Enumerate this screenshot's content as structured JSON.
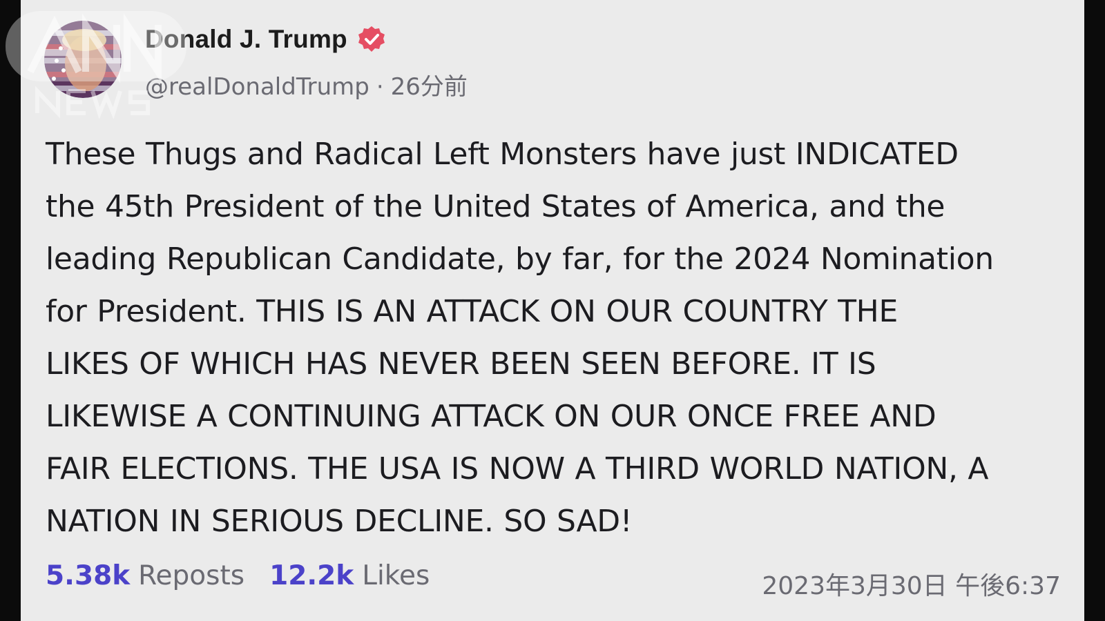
{
  "author": {
    "display_name": "Donald J. Trump",
    "handle": "@realDonaldTrump",
    "relative_time": "26分前",
    "separator": "·",
    "verified_icon": "verified-badge-icon",
    "verified_color": "#e54e63"
  },
  "post": {
    "lines": [
      "These Thugs and Radical Left Monsters have just INDICATED",
      "the 45th President of the United States of America, and the",
      "leading Republican Candidate, by far, for the 2024 Nomination",
      "for President. THIS IS AN ATTACK ON OUR COUNTRY THE",
      "LIKES OF WHICH HAS NEVER BEEN SEEN BEFORE. IT IS",
      "LIKEWISE A CONTINUING ATTACK ON OUR ONCE FREE AND",
      "FAIR ELECTIONS. THE USA IS NOW A THIRD WORLD NATION, A",
      "NATION IN SERIOUS DECLINE. SO SAD!"
    ]
  },
  "stats": {
    "reposts_count": "5.38k",
    "reposts_label": "Reposts",
    "likes_count": "12.2k",
    "likes_label": "Likes",
    "accent_color": "#4b42c9"
  },
  "timestamp": "2023年3月30日 午後6:37",
  "watermark": {
    "brand": "ANN NEWS"
  },
  "colors": {
    "card_background": "#ebebeb",
    "outer_background": "#0b0b0b",
    "text_primary": "#1c1c20",
    "text_secondary": "#6a6a72"
  }
}
